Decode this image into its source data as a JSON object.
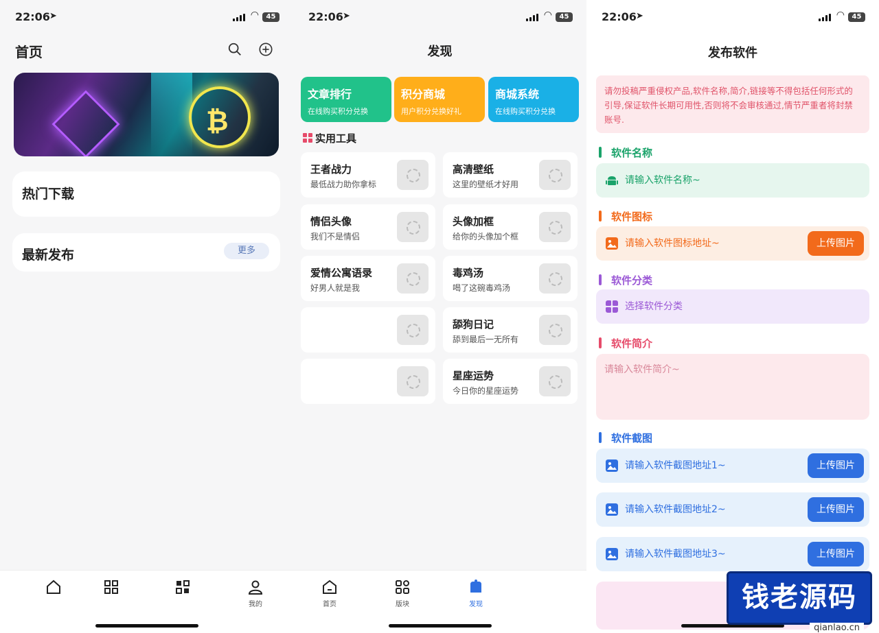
{
  "status": {
    "time": "22:06",
    "battery": "45"
  },
  "screen1": {
    "title": "首页",
    "hot_label": "热门下载",
    "latest_label": "最新发布",
    "more_label": "更多",
    "tabs": [
      {
        "label": "",
        "icon": "home-icon"
      },
      {
        "label": "",
        "icon": "grid-icon"
      },
      {
        "label": "",
        "icon": "apps-icon"
      },
      {
        "label": "我的",
        "icon": "user-icon"
      }
    ]
  },
  "screen2": {
    "title": "发现",
    "top_cards": [
      {
        "title": "文章排行",
        "sub": "在线购买积分兑换",
        "color": "#21c28a"
      },
      {
        "title": "积分商城",
        "sub": "用户积分兑换好礼",
        "color": "#ffae1a"
      },
      {
        "title": "商城系统",
        "sub": "在线购买积分兑换",
        "color": "#1ab0e6"
      }
    ],
    "section_title": "实用工具",
    "tools": [
      {
        "name": "王者战力",
        "desc": "最低战力助你拿标"
      },
      {
        "name": "高清壁纸",
        "desc": "这里的壁纸才好用"
      },
      {
        "name": "情侣头像",
        "desc": "我们不是情侣"
      },
      {
        "name": "头像加框",
        "desc": "给你的头像加个框"
      },
      {
        "name": "爱情公寓语录",
        "desc": "好男人就是我"
      },
      {
        "name": "毒鸡汤",
        "desc": "喝了这碗毒鸡汤"
      },
      {
        "name": "",
        "desc": ""
      },
      {
        "name": "舔狗日记",
        "desc": "舔到最后一无所有"
      },
      {
        "name": "",
        "desc": ""
      },
      {
        "name": "星座运势",
        "desc": "今日你的星座运势"
      }
    ],
    "tabs": [
      {
        "label": "首页",
        "icon": "home-icon"
      },
      {
        "label": "版块",
        "icon": "grid-icon"
      },
      {
        "label": "发现",
        "icon": "discover-icon"
      }
    ],
    "active_color": "#2f6fe0"
  },
  "screen3": {
    "title": "发布软件",
    "notice": "请勿投稿严重侵权产品,软件名称,简介,链接等不得包括任何形式的引导,保证软件长期可用性,否则将不会审核通过,情节严重者将封禁账号.",
    "fields": {
      "name": {
        "label": "软件名称",
        "placeholder": "请输入软件名称~",
        "color": "#1aa36a",
        "bg": "#e6f6ee"
      },
      "icon": {
        "label": "软件图标",
        "placeholder": "请输入软件图标地址~",
        "color": "#f26a1b",
        "bg": "#fdeee3",
        "button": "上传图片"
      },
      "category": {
        "label": "软件分类",
        "placeholder": "选择软件分类",
        "color": "#9b59d6",
        "bg": "#f1e8fb"
      },
      "intro": {
        "label": "软件简介",
        "placeholder": "请输入软件简介~",
        "color": "#e64b6a"
      },
      "screens": {
        "label": "软件截图",
        "color": "#2f6fe0",
        "bg": "#e6f1fc",
        "button": "上传图片",
        "items": [
          "请输入软件截图地址1~",
          "请输入软件截图地址2~",
          "请输入软件截图地址3~"
        ]
      }
    }
  },
  "watermark": {
    "text": "钱老源码",
    "url": "qianlao.cn"
  }
}
